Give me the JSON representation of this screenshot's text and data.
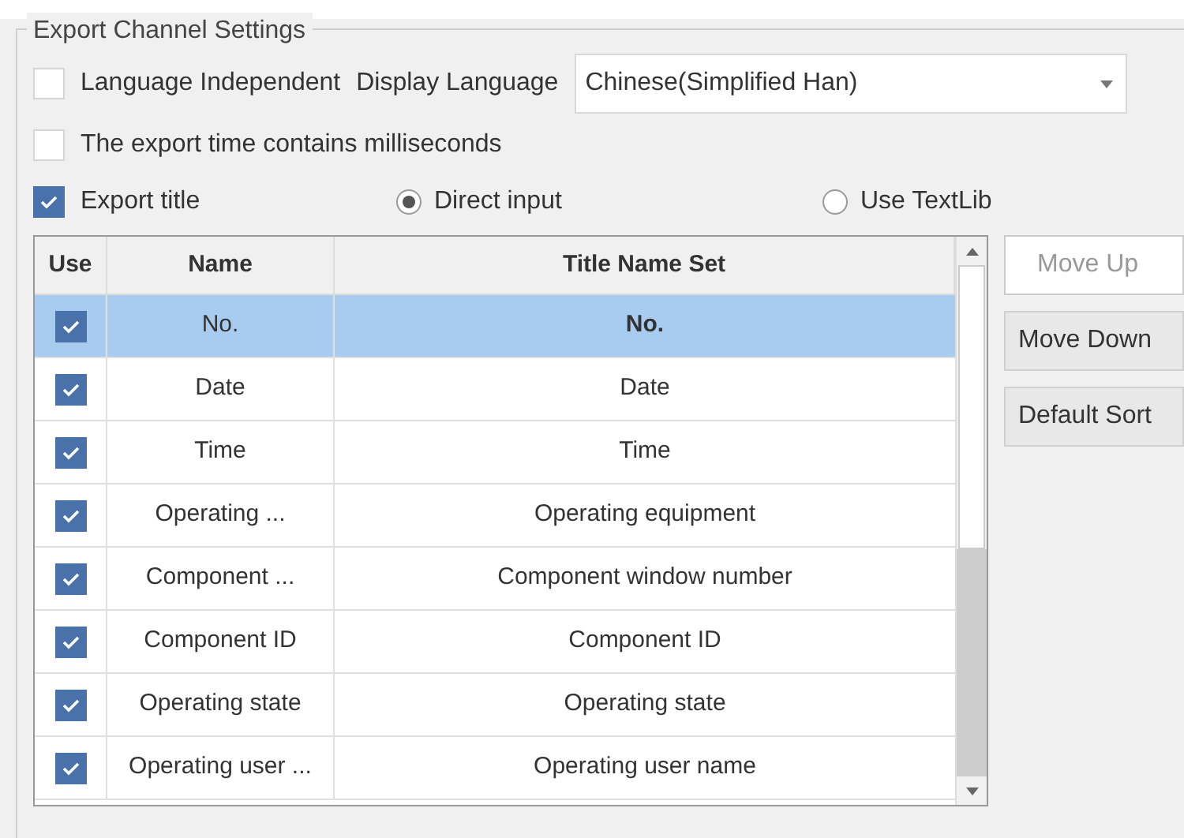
{
  "group_title": "Export Channel Settings",
  "language_independent": {
    "label": "Language Independent",
    "checked": false
  },
  "display_language": {
    "label": "Display Language",
    "value": "Chinese(Simplified Han)"
  },
  "milliseconds": {
    "label": "The export time contains milliseconds",
    "checked": false
  },
  "export_title": {
    "label": "Export title",
    "checked": true
  },
  "title_source": [
    {
      "label": "Direct input",
      "selected": true
    },
    {
      "label": "Use TextLib",
      "selected": false
    }
  ],
  "table": {
    "columns": [
      "Use",
      "Name",
      "Title Name Set"
    ],
    "rows": [
      {
        "use": true,
        "name": "No.",
        "title": "No.",
        "selected": true
      },
      {
        "use": true,
        "name": "Date",
        "title": "Date",
        "selected": false
      },
      {
        "use": true,
        "name": "Time",
        "title": "Time",
        "selected": false
      },
      {
        "use": true,
        "name": "Operating ...",
        "title": "Operating equipment",
        "selected": false
      },
      {
        "use": true,
        "name": "Component ...",
        "title": "Component window number",
        "selected": false
      },
      {
        "use": true,
        "name": "Component ID",
        "title": "Component ID",
        "selected": false
      },
      {
        "use": true,
        "name": "Operating state",
        "title": "Operating state",
        "selected": false
      },
      {
        "use": true,
        "name": "Operating user ...",
        "title": "Operating user name",
        "selected": false
      }
    ]
  },
  "buttons": [
    {
      "label": "Move Up",
      "disabled": true
    },
    {
      "label": "Move Down",
      "disabled": false
    },
    {
      "label": "Default Sort",
      "disabled": false
    }
  ]
}
